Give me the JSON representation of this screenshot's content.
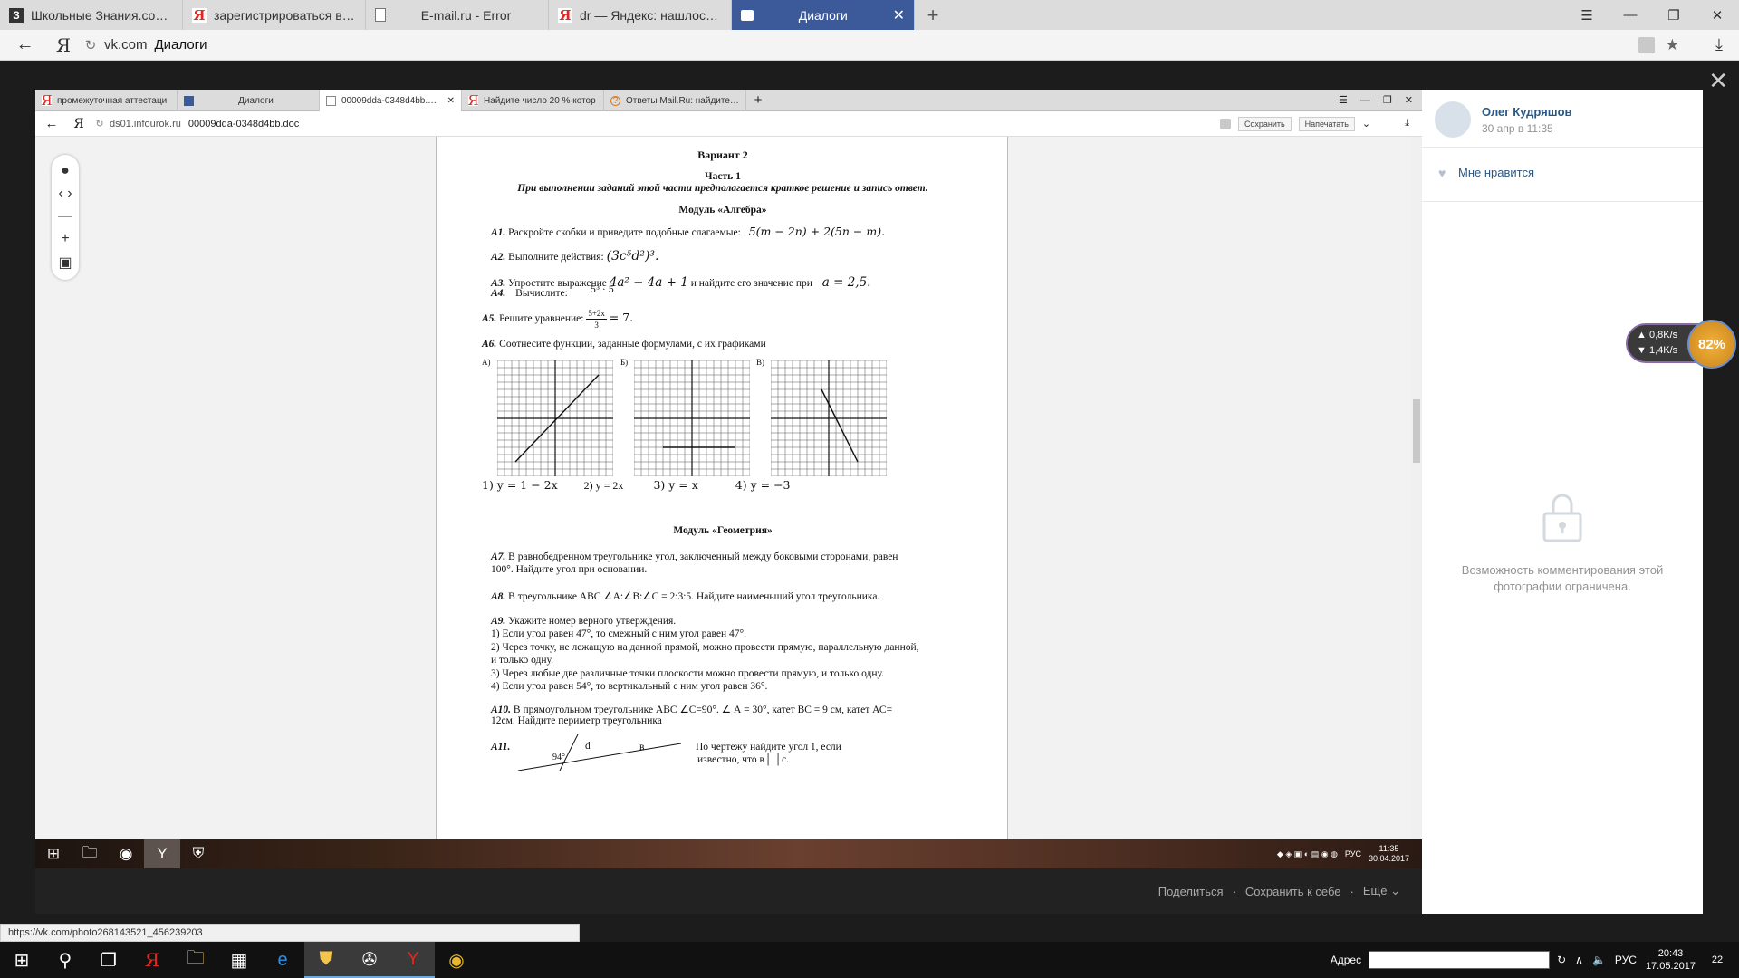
{
  "outer_browser": {
    "tabs": [
      {
        "icon": "znanija-icon",
        "label": "Школьные Знания.com - Ре"
      },
      {
        "icon": "yandex-icon",
        "label": "зарегистрироваться в эмей"
      },
      {
        "icon": "doc-icon",
        "label": "E-mail.ru - Error"
      },
      {
        "icon": "yandex-icon",
        "label": "dr — Яндекс: нашлось 235"
      },
      {
        "icon": "vk-icon",
        "label": "Диалоги",
        "active": true
      }
    ],
    "address_domain": "vk.com",
    "address_title": "Диалоги"
  },
  "inner_browser": {
    "tabs": [
      {
        "label": "промежуточная аттестаци"
      },
      {
        "label": "Диалоги"
      },
      {
        "label": "00009dda-0348d4bb.doc",
        "active": true
      },
      {
        "label": "Найдите число 20 % котор"
      },
      {
        "label": "Ответы Mail.Ru: найдите чи"
      }
    ],
    "address_domain": "ds01.infourok.ru",
    "address_file": "00009dda-0348d4bb.doc",
    "save_label": "Сохранить",
    "print_label": "Напечатать"
  },
  "document": {
    "variant": "Вариант 2",
    "part": "Часть 1",
    "instruction": "При выполнении заданий этой части предполагается краткое решение и запись ответ.",
    "module_algebra": "Модуль «Алгебра»",
    "a1_label": "А1.",
    "a1_text": "Раскройте скобки и приведите подобные слагаемые:",
    "a1_math": "5(m − 2n) + 2(5n − m).",
    "a2_label": "А2.",
    "a2_text": "Выполните действия:",
    "a2_math": "(3c⁵d²)³.",
    "a3_label": "А3.",
    "a3_text": "Упростите выражение",
    "a3_math": "4a² − 4a + 1",
    "a3_text2": "и найдите его значение при",
    "a3_math2": "a = 2,5.",
    "a4_label": "А4.",
    "a4_text": "Вычислите:",
    "a4_math": "5³ · 5",
    "a5_label": "А5.",
    "a5_text": "Решите уравнение:",
    "a5_num": "5+2x",
    "a5_den": "3",
    "a5_rhs": "= 7.",
    "a6_label": "А6.",
    "a6_text": "Соотнесите функции, заданные формулами, с их графиками",
    "graph_letters": [
      "А)",
      "Б)",
      "В)"
    ],
    "formulas": [
      "1) y = 1 − 2x",
      "2) y = 2x",
      "3) y = x",
      "4) y = −3"
    ],
    "module_geometry": "Модуль «Геометрия»",
    "a7_label": "А7.",
    "a7_line1": "В равнобедренном треугольнике угол, заключенный между боковыми сторонами, равен",
    "a7_line2": "100°. Найдите угол при основании.",
    "a8_label": "А8.",
    "a8_text": "В треугольнике АВС ∠А:∠В:∠С = 2:3:5. Найдите наименьший угол треугольника.",
    "a9_label": "А9.",
    "a9_text": "Укажите номер верного утверждения.",
    "a9_items": [
      "1) Если угол равен 47°, то смежный с ним угол равен 47°.",
      "2) Через точку, не лежащую на данной прямой, можно провести прямую, параллельную данной,",
      "и только одну.",
      "3) Через любые две различные точки плоскости можно провести прямую, и только одну.",
      "4) Если угол равен 54°, то вертикальный с ним угол равен 36°."
    ],
    "a10_label": "А10.",
    "a10_line1": "В прямоугольном треугольнике АВС  ∠С=90°.  ∠ А = 30°,  катет ВС = 9 см, катет АС=",
    "a10_line2": "12см. Найдите периметр треугольника",
    "a11_label": "А11.",
    "a11_angle": "94°",
    "a11_d": "d",
    "a11_b": "в",
    "a11_line1": "По чертежу найдите угол 1, если",
    "a11_line2": "известно, что в│ │с."
  },
  "inner_taskbar": {
    "clock_time": "11:35",
    "clock_date": "30.04.2017",
    "lang": "РУС"
  },
  "photo_actions": {
    "share": "Поделиться",
    "save": "Сохранить к себе",
    "more": "Ещё"
  },
  "vk_panel": {
    "author": "Олег Кудряшов",
    "date": "30 апр в 11:35",
    "like": "Мне нравится",
    "restricted": "Возможность комментирования этой фотографии ограничена."
  },
  "speed_widget": {
    "up": "0,8K/s",
    "down": "1,4K/s",
    "percent": "82%"
  },
  "status_url": "https://vk.com/photo268143521_456239203",
  "taskbar": {
    "address_label": "Адрес",
    "lang": "РУС",
    "time": "20:43",
    "date": "17.05.2017",
    "notifications": "22"
  }
}
